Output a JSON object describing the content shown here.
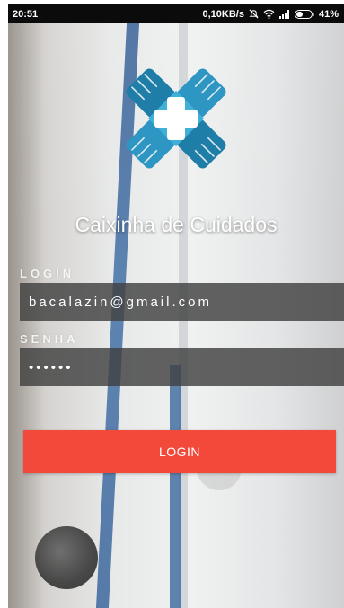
{
  "status_bar": {
    "time": "20:51",
    "network_speed": "0,10KB/s",
    "battery": "41%",
    "icons": [
      "mute-icon",
      "wifi-icon",
      "signal-icon",
      "battery-icon"
    ]
  },
  "app": {
    "title": "Caixinha de Cuidados",
    "logo": "hands-cross-logo",
    "accent_color": "#f2493b"
  },
  "form": {
    "login_label": "LOGIN",
    "login_value": "bacalazin@gmail.com",
    "password_label": "SENHA",
    "password_value": "••••••",
    "submit_label": "LOGIN"
  }
}
